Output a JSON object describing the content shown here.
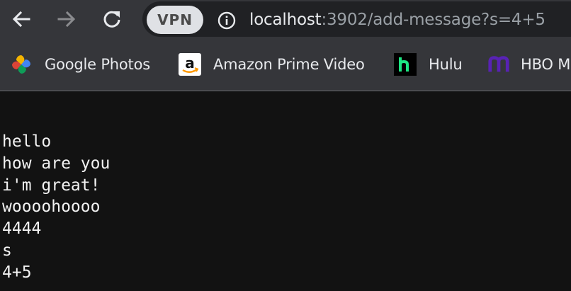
{
  "toolbar": {
    "vpn_label": "VPN",
    "url_host": "localhost",
    "url_rest": ":3902/add-message?s=4+5",
    "icons": {
      "back": "arrow-left-icon",
      "forward": "arrow-right-icon",
      "reload": "reload-icon",
      "info": "info-icon"
    }
  },
  "bookmarks": [
    {
      "label": "Google Photos",
      "icon": "google-photos-icon"
    },
    {
      "label": "Amazon Prime Video",
      "icon": "amazon-icon"
    },
    {
      "label": "Hulu",
      "icon": "hulu-icon"
    },
    {
      "label": "HBO M",
      "icon": "hbo-max-icon"
    }
  ],
  "messages": [
    "hello",
    "how are you",
    "i'm great!",
    "woooohoooo",
    "4444",
    "s",
    "4+5"
  ],
  "colors": {
    "toolbar_bg": "#35363a",
    "omnibox_bg": "#202124",
    "page_bg": "#121212",
    "text": "#e8eaed",
    "muted_text": "#9aa0a6",
    "hulu_green": "#1ce783",
    "hbo_purple": "#5822b4"
  }
}
